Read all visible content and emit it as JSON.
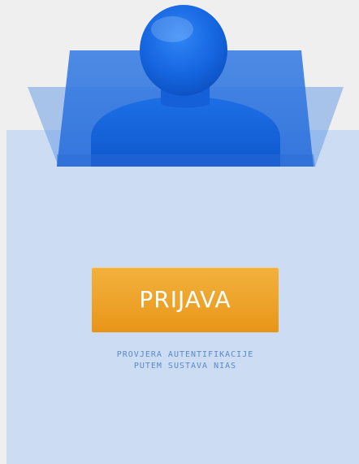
{
  "login": {
    "button_label": "PRIJAVA",
    "caption_line1": "PROVJERA AUTENTIFIKACIJE",
    "caption_line2": "PUTEM SUSTAVA NIAS"
  },
  "colors": {
    "background": "#efefef",
    "panel": "#cbdcf3",
    "button": "#eda32a",
    "button_text": "#ffffff",
    "caption": "#5d89c9",
    "avatar": "#1e68d8"
  },
  "icons": {
    "hero": "user-avatar-icon"
  }
}
